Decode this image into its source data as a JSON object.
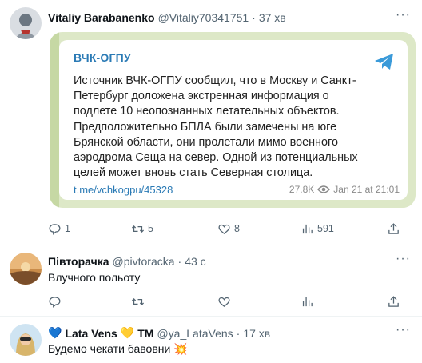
{
  "tweets": [
    {
      "name": "Vitaliy Barabanenko",
      "handle": "@Vitaliy70341751",
      "dot": "·",
      "time": "37 хв",
      "card": {
        "channel": "ВЧК-ОГПУ",
        "lines": [
          "Источник ВЧК-ОГПУ сообщил, что в Москву и Санкт-",
          "Петербург доложена экстренная информация о",
          "подлете 10 неопознанных летательных объектов.",
          "Предположительно БПЛА были замечены на юге",
          "Брянской области, они пролетали мимо военного",
          "аэродрома Сеща на север. Одной из потенциальных",
          "целей может вновь стать Северная столица."
        ],
        "link": "t.me/vchkogpu/45328",
        "views": "27.8K",
        "date": "Jan 21 at 21:01"
      },
      "actions": {
        "replies": "1",
        "retweets": "5",
        "likes": "8",
        "views": "591"
      }
    },
    {
      "name": "Півторачка",
      "handle": "@pivtoracka",
      "dot": "·",
      "time": "43 с",
      "text": "Влучного польоту"
    },
    {
      "name_prefix": "💙",
      "name": "Lata Vens",
      "name_suffix": "💛",
      "tm": "TM",
      "handle": "@ya_LataVens",
      "dot": "·",
      "time": "17 хв",
      "text": "Будемо чекати бавовни 💥"
    }
  ],
  "icons": {
    "reply": "reply-icon",
    "retweet": "retweet-icon",
    "like": "heart-icon",
    "views": "views-icon",
    "share": "share-icon",
    "more": "more-icon",
    "telegram": "telegram-icon"
  },
  "colors": {
    "link": "#2a7ab5",
    "card_bg": "#dde8c7",
    "muted": "#536471"
  }
}
